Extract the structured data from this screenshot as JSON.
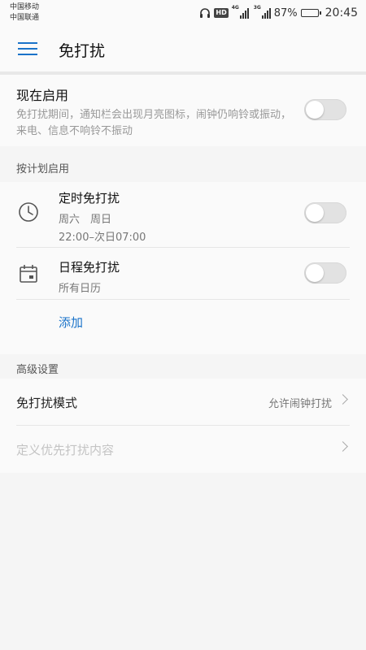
{
  "status_bar": {
    "carrier1": "中国移动",
    "carrier2": "中国联通",
    "hd": "HD",
    "net1": "4G",
    "net2": "3G",
    "battery_percent": "87%",
    "battery_level": 0.87,
    "time": "20:45"
  },
  "app_bar": {
    "title": "免打扰"
  },
  "now": {
    "title": "现在启用",
    "description": "免打扰期间，通知栏会出现月亮图标，闹钟仍响铃或振动，来电、信息不响铃不振动",
    "enabled": false
  },
  "schedule": {
    "header": "按计划启用",
    "timed": {
      "title": "定时免打扰",
      "days": "周六　周日",
      "time_range": "22:00–次日07:00",
      "enabled": false
    },
    "calendar": {
      "title": "日程免打扰",
      "subtitle": "所有日历",
      "enabled": false
    },
    "add_label": "添加"
  },
  "advanced": {
    "header": "高级设置",
    "mode_label": "免打扰模式",
    "mode_value": "允许闹钟打扰",
    "priority_label": "定义优先打扰内容"
  },
  "colors": {
    "accent": "#1a73c9",
    "background": "#f5f5f5"
  }
}
